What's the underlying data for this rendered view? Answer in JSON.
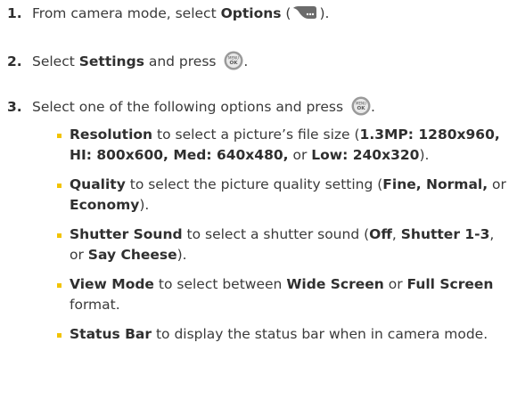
{
  "steps": [
    {
      "num": "1.",
      "pre": "From camera mode, select ",
      "bold": "Options",
      "post_open": " (",
      "post_close": ")."
    },
    {
      "num": "2.",
      "pre": "Select ",
      "bold": "Settings",
      "mid": " and press ",
      "end": "."
    },
    {
      "num": "3.",
      "text": "Select one of the following options and press ",
      "end": "."
    }
  ],
  "icons": {
    "softkey": "options-softkey-icon",
    "menu_ok": "menu-ok-button-icon",
    "menu_text": "MENU",
    "ok_text": "OK"
  },
  "bullets": [
    {
      "label": "Resolution",
      "text": " to select a picture’s file size (",
      "opt1": "1.3MP: 1280x960, HI: 800x600, Med: 640x480,",
      "or": " or ",
      "opt2": "Low: 240x320",
      "close": ")."
    },
    {
      "label": "Quality",
      "text": " to select the picture quality setting (",
      "opt1": "Fine, Normal,",
      "or": " or ",
      "opt2": "Economy",
      "close": ")."
    },
    {
      "label": "Shutter Sound",
      "text": " to select a shutter sound (",
      "opt1": "Off",
      "sep": ", ",
      "opt2": "Shutter 1-3",
      "or": ", or ",
      "opt3": "Say Cheese",
      "close": ")."
    },
    {
      "label": "View Mode",
      "text": " to select between ",
      "opt1": "Wide Screen",
      "or": " or ",
      "opt2": "Full Screen",
      "close": " format."
    },
    {
      "label": "Status Bar",
      "text": " to display the status bar when in camera mode."
    }
  ],
  "colors": {
    "bullet": "#f2c300",
    "text": "#3a3a3a"
  }
}
